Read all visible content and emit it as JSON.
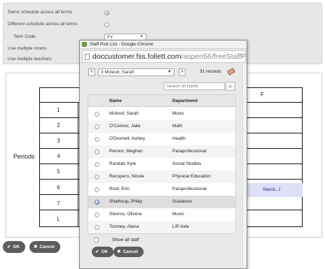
{
  "options": {
    "same_schedule": "Same schedule across all terms",
    "different_schedule": "Different schedule across all terms",
    "term_code": "Term Code",
    "term_code_value": "FY",
    "use_multiple_rooms": "Use multiple rooms",
    "use_multiple_teachers": "Use multiple teachers"
  },
  "schedule": {
    "periods_label": "Periods",
    "day_header": "F",
    "periods": [
      "1",
      "2",
      "3",
      "4",
      "5",
      "6",
      "7",
      "L"
    ],
    "assigned_cell": "Starck, J"
  },
  "background_buttons": {
    "ok": "OK",
    "cancel": "Cancel"
  },
  "popup": {
    "window_title": "Staff Pick List - Google Chrome",
    "url_host": "doccustomer.fss.follett.com",
    "url_path": "/aspen56/freeStaffPickList.d",
    "nav": {
      "prev": "<",
      "next": ">",
      "selected_staff": "3 Mcleod, Sarah",
      "records": "31 records"
    },
    "search_placeholder": "Search on Name",
    "columns": {
      "name": "Name",
      "department": "Department"
    },
    "rows": [
      {
        "name": "Mcleod, Sarah",
        "department": "Music"
      },
      {
        "name": "O'Connor, Jake",
        "department": "Math"
      },
      {
        "name": "O'Donnell, Ashley",
        "department": "Health"
      },
      {
        "name": "Pennor, Meghan",
        "department": "Paraprofessional"
      },
      {
        "name": "Randall, Kyle",
        "department": "Social Studies"
      },
      {
        "name": "Recupero, Nicole",
        "department": "Physical Education"
      },
      {
        "name": "Root, Erin",
        "department": "Paraprofessional"
      },
      {
        "name": "Shalhoup, Philip",
        "department": "Guidance"
      },
      {
        "name": "Stavros, Olivera",
        "department": "Music"
      },
      {
        "name": "Toomey, Alana",
        "department": "L/P Aide"
      }
    ],
    "show_all_label": "Show all staff",
    "ok": "OK",
    "cancel": "Cancel"
  }
}
